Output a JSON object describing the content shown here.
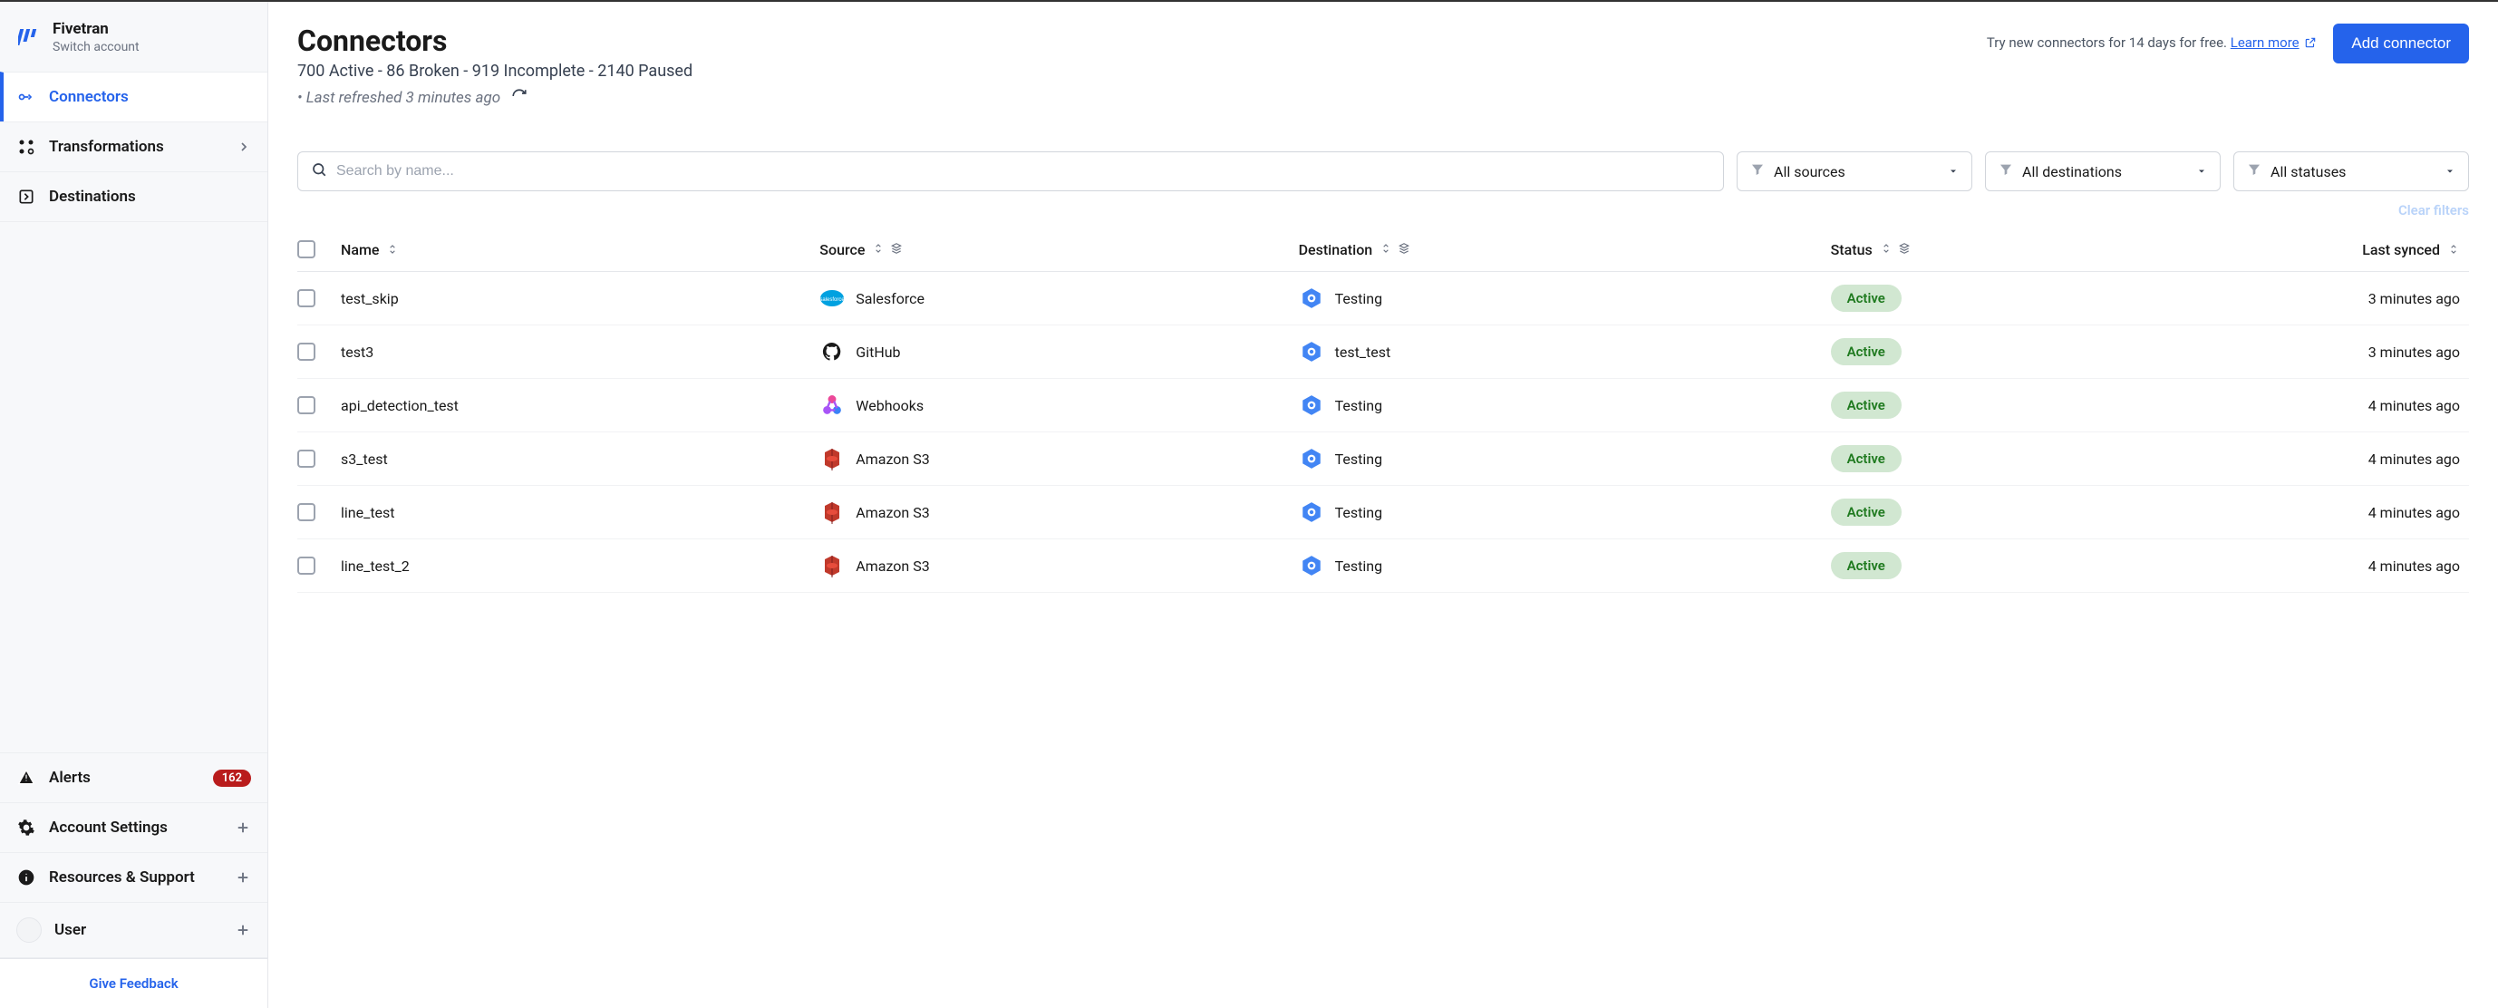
{
  "brand": {
    "name": "Fivetran",
    "switch_account": "Switch account"
  },
  "sidebar": {
    "items": [
      {
        "label": "Connectors"
      },
      {
        "label": "Transformations"
      },
      {
        "label": "Destinations"
      },
      {
        "label": "Alerts",
        "badge": "162"
      },
      {
        "label": "Account Settings"
      },
      {
        "label": "Resources & Support"
      },
      {
        "label": "User"
      }
    ],
    "feedback": "Give Feedback"
  },
  "header": {
    "title": "Connectors",
    "subtitle": "700 Active - 86 Broken - 919 Incomplete - 2140 Paused",
    "refresh_prefix": "• ",
    "refresh_text": "Last refreshed 3 minutes ago",
    "trial_text": "Try new connectors for 14 days for free. ",
    "learn_more": "Learn more",
    "add_connector": "Add connector"
  },
  "filters": {
    "search_placeholder": "Search by name...",
    "sources": "All sources",
    "destinations": "All destinations",
    "statuses": "All statuses",
    "clear": "Clear filters"
  },
  "table": {
    "headers": {
      "name": "Name",
      "source": "Source",
      "destination": "Destination",
      "status": "Status",
      "last_synced": "Last synced"
    },
    "rows": [
      {
        "name": "test_skip",
        "source": "Salesforce",
        "source_icon": "salesforce",
        "destination": "Testing",
        "status": "Active",
        "last_synced": "3 minutes ago"
      },
      {
        "name": "test3",
        "source": "GitHub",
        "source_icon": "github",
        "destination": "test_test",
        "status": "Active",
        "last_synced": "3 minutes ago"
      },
      {
        "name": "api_detection_test",
        "source": "Webhooks",
        "source_icon": "webhooks",
        "destination": "Testing",
        "status": "Active",
        "last_synced": "4 minutes ago"
      },
      {
        "name": "s3_test",
        "source": "Amazon S3",
        "source_icon": "s3",
        "destination": "Testing",
        "status": "Active",
        "last_synced": "4 minutes ago"
      },
      {
        "name": "line_test",
        "source": "Amazon S3",
        "source_icon": "s3",
        "destination": "Testing",
        "status": "Active",
        "last_synced": "4 minutes ago"
      },
      {
        "name": "line_test_2",
        "source": "Amazon S3",
        "source_icon": "s3",
        "destination": "Testing",
        "status": "Active",
        "last_synced": "4 minutes ago"
      }
    ]
  }
}
